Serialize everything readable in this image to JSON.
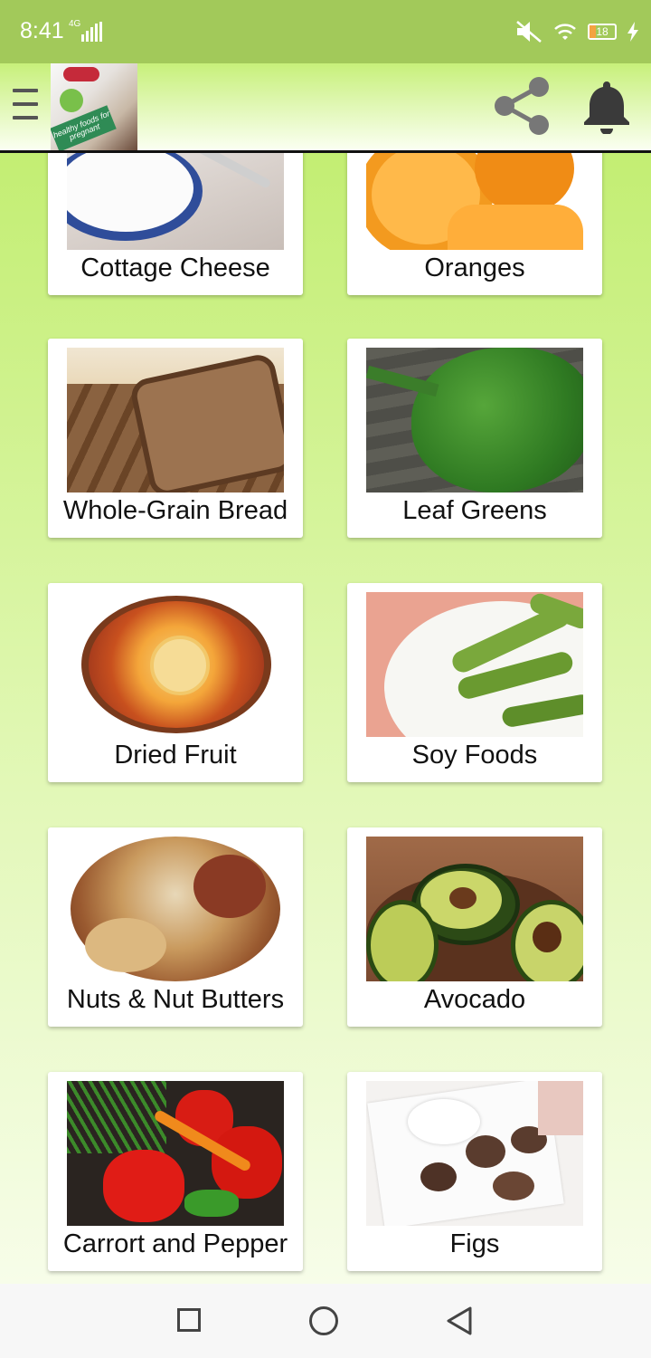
{
  "status_bar": {
    "time": "8:41",
    "network": "4G",
    "battery_level": "18"
  },
  "app_bar": {
    "menu_icon": "hamburger-menu-icon",
    "logo_text": "healthy foods for pregnant",
    "share_icon": "share-icon",
    "notification_icon": "bell-icon"
  },
  "foods": [
    {
      "label": "Cottage Cheese"
    },
    {
      "label": "Oranges"
    },
    {
      "label": "Whole-Grain Bread"
    },
    {
      "label": "Leaf Greens"
    },
    {
      "label": "Dried Fruit"
    },
    {
      "label": "Soy Foods"
    },
    {
      "label": "Nuts & Nut Butters"
    },
    {
      "label": "Avocado"
    },
    {
      "label": "Carrort and Pepper"
    },
    {
      "label": "Figs"
    }
  ],
  "nav_bar": {
    "recents_icon": "square-icon",
    "home_icon": "circle-icon",
    "back_icon": "triangle-back-icon"
  },
  "colors": {
    "status_bar": "#a2c95a",
    "app_bar_top": "#c7f07a",
    "background_top": "#c3ee73"
  }
}
